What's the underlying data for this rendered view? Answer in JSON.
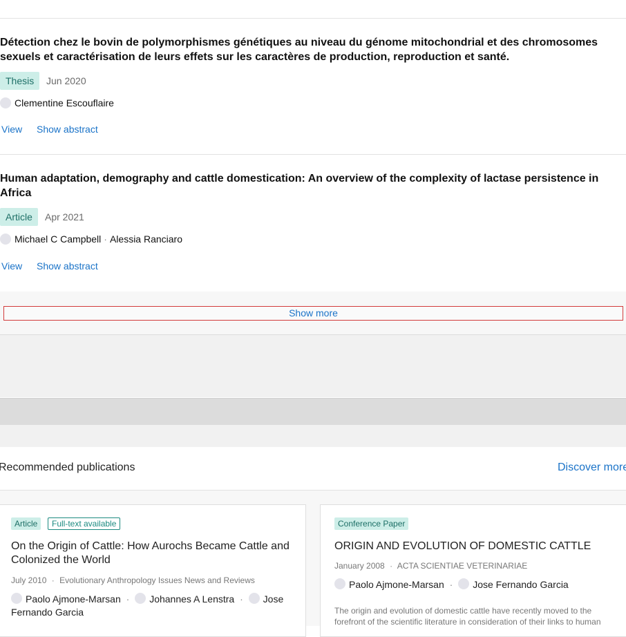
{
  "publications": [
    {
      "title": "Détection chez le bovin de polymorphismes génétiques au niveau du génome mitochondrial et des chromosomes sexuels et caractérisation de leurs effets sur les caractères de production, reproduction et santé.",
      "type": "Thesis",
      "date": "Jun 2020",
      "authors": [
        "Clementine Escouflaire"
      ],
      "view_label": "View",
      "abstract_label": "Show abstract"
    },
    {
      "title": "Human adaptation, demography and cattle domestication: An overview of the complexity of lactase persistence in Africa",
      "type": "Article",
      "date": "Apr 2021",
      "authors": [
        "Michael C Campbell",
        "Alessia Ranciaro"
      ],
      "view_label": "View",
      "abstract_label": "Show abstract"
    }
  ],
  "show_more_label": "Show more",
  "recommended": {
    "heading": "Recommended publications",
    "discover_label": "Discover more",
    "cards": [
      {
        "type": "Article",
        "fulltext": "Full-text available",
        "title": "On the Origin of Cattle: How Aurochs Became Cattle and Colonized the World",
        "date": "July 2010",
        "venue": "Evolutionary Anthropology Issues News and Reviews",
        "authors": [
          "Paolo Ajmone-Marsan",
          "Johannes A Lenstra",
          "Jose Fernando Garcia"
        ]
      },
      {
        "type": "Conference Paper",
        "title": "ORIGIN AND EVOLUTION OF DOMESTIC CATTLE",
        "date": "January 2008",
        "venue": "ACTA SCIENTIAE VETERINARIAE",
        "authors": [
          "Paolo Ajmone-Marsan",
          "Jose Fernando Garcia"
        ],
        "abstract": "The origin and evolution of domestic cattle have recently moved to the forefront of the scientific literature in consideration of their links to human"
      }
    ]
  },
  "separator": "·",
  "colors": {
    "link": "#1a73c8",
    "badge_bg": "#cdeee8",
    "badge_text": "#1d6f66",
    "focus_outline": "#d23a3a"
  }
}
